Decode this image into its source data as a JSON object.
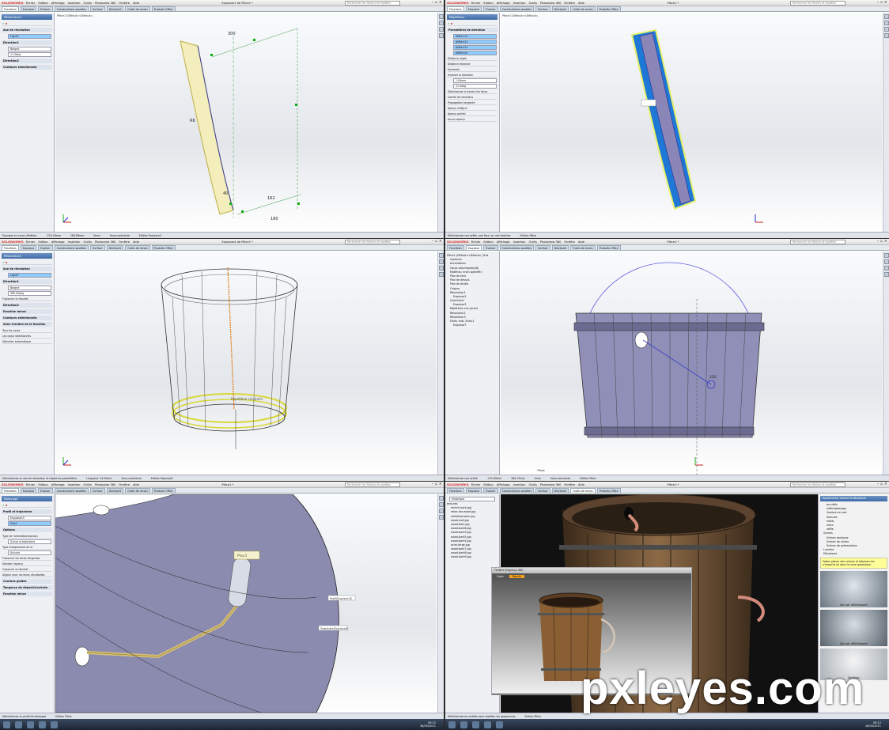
{
  "watermark": "pxleyes.com",
  "app": {
    "logo": "SOLIDWORKS",
    "menu": [
      "Fichier",
      "Edition",
      "Affichage",
      "Insertion",
      "Outils",
      "Photoview 360",
      "Fenêtre",
      "Aide"
    ],
    "search_placeholder": "Rechercher les fichiers et modèles",
    "tabs": [
      "Fonctions",
      "Esquisse",
      "Evaluer",
      "Constructions soudées",
      "Surface",
      "DimXpert",
      "Outils de rendu",
      "Produits Office"
    ]
  },
  "panels": [
    {
      "doc_title": "Esquisse1 de Pièce1 *",
      "tree_header": "Pièce1 (Défaut<<Défaut>_",
      "pm_title": "Révolution1",
      "pm_rows": [
        "Axe de révolution",
        "Ligne7",
        "Direction1",
        "Borgne",
        "11.0deg",
        "Direction2",
        "Contours sélectionnés"
      ],
      "status": [
        "Esquisse en cours d'édition",
        "-220.28mm",
        "180.89mm",
        "0mm",
        "Sous-contrainte",
        "Edition Esquisse4"
      ],
      "dims": [
        "300",
        "R6",
        "162",
        "180",
        "40"
      ]
    },
    {
      "doc_title": "Pièce1 *",
      "tree_header": "Pièce1 (Défaut<<Défaut>_",
      "pm_title": "Répétition",
      "pm_rows": [
        "Paramètres de direction",
        "Arête<1>",
        "Arête<2>",
        "Arête<3>",
        "Arête<4>",
        "Distance angle",
        "Distance distance",
        "Sommets",
        "Inverser la direction",
        "1.00mm",
        "11.0deg",
        "Sélectionner à travers les faces",
        "Garder les fonctions",
        "Propagation tangente",
        "Aperçu intégral",
        "Aperçu partiel",
        "Aucun aperçu"
      ],
      "status": [
        "Sélectionnez une arête, une face, ou une fonction",
        "Edition Pièce"
      ]
    },
    {
      "doc_title": "Esquisse4 de Pièce1 *",
      "tree_header": "Pièce1 (Défaut<<Défaut>_",
      "pm_title": "Révolution1",
      "pm_rows": [
        "Axe de révolution",
        "Ligne7",
        "Direction1",
        "Borgne",
        "360.00deg",
        "Fusionner le résultat",
        "Direction2",
        "Fonction mince",
        "Contours sélectionnés",
        "Zone d'action de la fonction",
        "Tous les corps",
        "Les corps sélectionnés",
        "Sélection automatique"
      ],
      "status": [
        "Sélectionnez un axe de révolution et réglez les paramètres",
        "Longueur: 14.29mm",
        "Sous-contrainte",
        "Edition Esquisse5"
      ],
      "label_in_view": "Répétition circulaire"
    },
    {
      "doc_title": "Pièce1 *",
      "tree": [
        "Pièce1 (Défaut<<Défaut>_Etat",
        "Capteurs",
        "Annotations",
        "Corps volumiques(26)",
        "Matériau <non spécifié>",
        "Plan de face",
        "Plan de dessus",
        "Plan de droite",
        "Origine",
        "Révolution1",
        "Esquisse1",
        "Chanfrein1",
        "Esquisse3",
        "Répétition circ.(acier)",
        "Révolution2",
        "Révolution3",
        "Enlèv. mat. Extru1",
        "Esquisse7"
      ],
      "status": [
        "Sélectionnez une entité",
        "-471.89mm",
        "280.23mm",
        "0mm",
        "Sous-contrainte",
        "Edition Pièce"
      ],
      "dim_label": "220",
      "label_in_view": "*Face"
    },
    {
      "doc_title": "Pièce1 *",
      "pm_title": "Balayage",
      "pm_rows": [
        "Profil et trajectoire",
        "Esquisse10",
        "Plan1",
        "Options",
        "Type de l'orientation/torsion",
        "Suivre la trajectoire",
        "Type d'alignement de la",
        "Aucune",
        "Fusionner les faces tangentes",
        "Montrer l'aperçu",
        "Fusionner le résultat",
        "Aligner avec les faces résultantes",
        "Courbes guides",
        "Tangence de départ/d'arrivée",
        "Fonction mince"
      ],
      "labels_in_view": [
        "Plan1",
        "Profil(Esquisse10)",
        "Trajectoire(Esquisse9)"
      ],
      "status": [
        "Sélectionnez un profil de balayage",
        "Edition Pièce"
      ]
    },
    {
      "doc_title": "Pièce1 *",
      "appearance_tree": [
        "textures",
        "ehrlich-bark.jpg",
        "rebar-bar-wood.jpg",
        "metaltext-plan.jpg",
        "wood-wall.jpg",
        "wood-bark.jpg",
        "wood-bark6.jpg",
        "wood-bark3.jpg",
        "wood-bark5.jpg",
        "wood-bark4.jpg",
        "acier-forge.jpg",
        "wood-bark7.jpg",
        "wood-bark8.jpg",
        "wood-bark9.jpg"
      ],
      "appearance_dropdown": "Historique",
      "render_window_title": "Fenêtre d'Aperçu 360",
      "render_tabs": [
        "Caler",
        "Rendu"
      ],
      "taskpane_title": "Apparences, scènes et décalques",
      "taskpane_tree": [
        "occultés",
        "mfibreglassagy",
        "Sombre en mat",
        "textures",
        "métal",
        "verre",
        "raffle",
        "Scènes",
        "Scènes basiques",
        "Scènes de studio",
        "Scènes de présentation",
        "Lumière",
        "Décalques"
      ],
      "taskpane_hint": "Faites glisser des scènes et déposez-les n'importe où dans la zone graphique.",
      "thumbs": [
        "Sol noir réfléchissant",
        "Sol noir réfléchissant",
        "Sol blanc"
      ],
      "status": [
        "Sélectionnez les entités pour modifier les apparences",
        "Edition Pièce"
      ]
    }
  ],
  "taskbar": {
    "time": "09:12",
    "date": "16/05/2011"
  }
}
